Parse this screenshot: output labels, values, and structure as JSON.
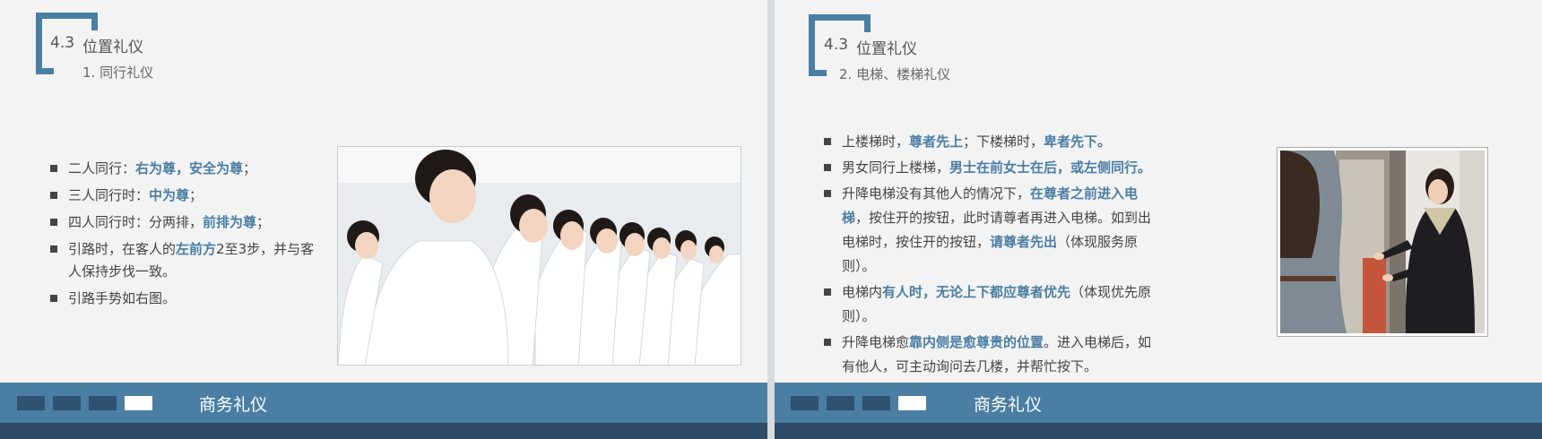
{
  "left_slide": {
    "section_number": "4.3",
    "section_title": "位置礼仪",
    "subtitle": "1. 同行礼仪",
    "bullets": [
      {
        "pre": "二人同行：",
        "hl": "右为尊，安全为尊",
        "post": "；"
      },
      {
        "pre": "三人同行时：",
        "hl": "中为尊",
        "post": "；"
      },
      {
        "pre": "四人同行时：分两排，",
        "hl": "前排为尊",
        "post": "；"
      },
      {
        "pre": "引路时，在客人的",
        "hl": "左前方",
        "post": "2至3步，并与客人保持步伐一致。"
      },
      {
        "pre": "引路手势如右图。",
        "hl": "",
        "post": ""
      }
    ],
    "photo": "row-of-women-in-white-gesturing",
    "footer_label": "商务礼仪"
  },
  "right_slide": {
    "section_number": "4.3",
    "section_title": "位置礼仪",
    "subtitle": "2. 电梯、楼梯礼仪",
    "bullets": [
      {
        "pre": "上楼梯时，",
        "hl": "尊者先上",
        "mid": "；下楼梯时，",
        "hl2": "卑者先下。",
        "post": ""
      },
      {
        "pre": "男女同行上楼梯，",
        "hl": "男士在前女士在后，或左侧同行。",
        "mid": "",
        "hl2": "",
        "post": ""
      },
      {
        "pre": "升降电梯没有其他人的情况下，",
        "hl": "在尊者之前进入电梯",
        "mid": "，按住开的按钮，此时请尊者再进入电梯。如到出电梯时，按住开的按钮，",
        "hl2": "请尊者先出",
        "post": "（体现服务原则）。"
      },
      {
        "pre": "电梯内",
        "hl": "有人时，无论上下都应尊者优先",
        "mid": "（体现优先原则）。",
        "hl2": "",
        "post": ""
      },
      {
        "pre": "升降电梯愈",
        "hl": "靠内侧是愈尊贵的位置",
        "mid": "。进入电梯后，如有他人，可主动询问去几楼，并帮忙按下。",
        "hl2": "",
        "post": ""
      }
    ],
    "photo": "woman-guiding-guest-into-elevator",
    "footer_label": "商务礼仪"
  },
  "colors": {
    "accent": "#4a7ea3",
    "footer_dark": "#2e4a66",
    "square": "#2f5272",
    "slide_bg": "#f3f3f4"
  }
}
